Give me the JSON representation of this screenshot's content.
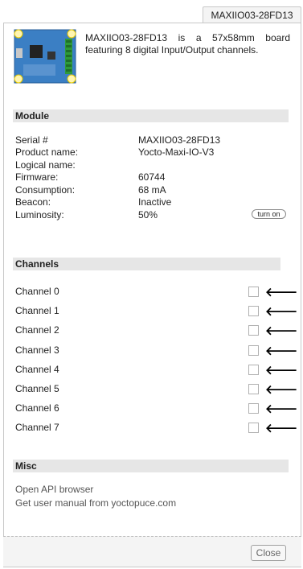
{
  "tab": {
    "label": "MAXIIO03-28FD13"
  },
  "header": {
    "description": "MAXIIO03-28FD13 is a 57x58mm board featuring 8 digital Input/Output channels."
  },
  "module": {
    "title": "Module",
    "rows": [
      {
        "label": "Serial #",
        "value": "MAXIIO03-28FD13"
      },
      {
        "label": "Product name:",
        "value": "Yocto-Maxi-IO-V3"
      },
      {
        "label": "Logical name:",
        "value": ""
      },
      {
        "label": "Firmware:",
        "value": "60744"
      },
      {
        "label": "Consumption:",
        "value": "68 mA"
      },
      {
        "label": "Beacon:",
        "value": "Inactive"
      },
      {
        "label": "Luminosity:",
        "value": "50%"
      }
    ],
    "beacon_button": "turn on"
  },
  "channels": {
    "title": "Channels",
    "items": [
      {
        "label": "Channel 0",
        "checked": false,
        "arrow": "🡐"
      },
      {
        "label": "Channel 1",
        "checked": false,
        "arrow": "🡐"
      },
      {
        "label": "Channel 2",
        "checked": false,
        "arrow": "🡐"
      },
      {
        "label": "Channel 3",
        "checked": false,
        "arrow": "🡐"
      },
      {
        "label": "Channel 4",
        "checked": false,
        "arrow": "🡐"
      },
      {
        "label": "Channel 5",
        "checked": false,
        "arrow": "🡐"
      },
      {
        "label": "Channel 6",
        "checked": false,
        "arrow": "🡐"
      },
      {
        "label": "Channel 7",
        "checked": false,
        "arrow": "🡐"
      }
    ]
  },
  "misc": {
    "title": "Misc",
    "links": [
      "Open API browser",
      "Get user manual from yoctopuce.com"
    ]
  },
  "footer": {
    "close_label": "Close"
  }
}
